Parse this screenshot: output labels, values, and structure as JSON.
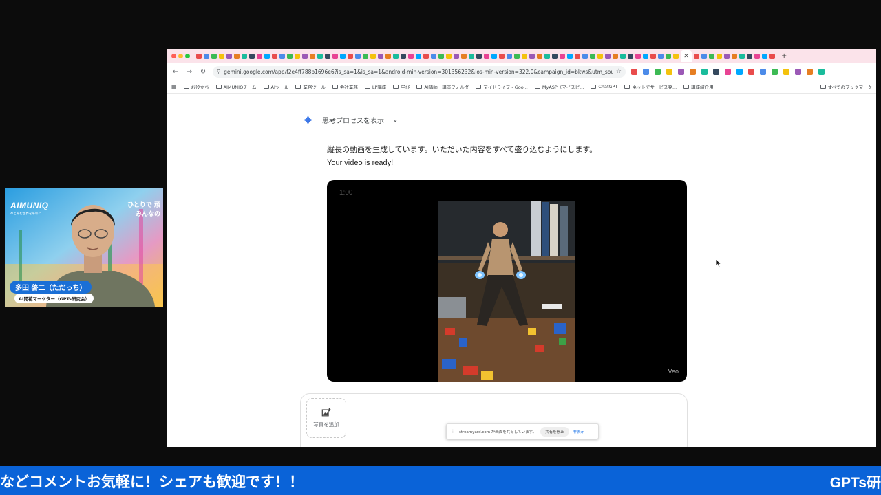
{
  "browser": {
    "url": "gemini.google.com/app/f2e4ff788b1696e6?is_sa=1&is_sa=1&android-min-version=301356232&ios-min-version=322.0&campaign_id=bkws&utm_source=...",
    "tab_active_label": "✕",
    "new_tab_label": "+",
    "nav": {
      "back": "←",
      "forward": "→",
      "reload": "↻"
    },
    "bookmarks": [
      {
        "label": "お役立ち"
      },
      {
        "label": "AIMUNIQチーム"
      },
      {
        "label": "AIツール"
      },
      {
        "label": "業務ツール"
      },
      {
        "label": "会社業務"
      },
      {
        "label": "LP講座"
      },
      {
        "label": "学び"
      },
      {
        "label": "AI講師　講座フォルダ"
      },
      {
        "label": "マイドライブ - Goo..."
      },
      {
        "label": "MyASP（マイスピ..."
      },
      {
        "label": "ChatGPT"
      },
      {
        "label": "ネットでサービス発..."
      },
      {
        "label": "講座紹介用"
      }
    ],
    "bookmarks_all": "すべてのブックマーク"
  },
  "gemini": {
    "thinking_label": "思考プロセスを表示",
    "chevron": "⌄",
    "message_line1": "縦長の動画を生成しています。いただいた内容をすべて盛り込むようにします。",
    "message_line2": "Your video is ready!",
    "video": {
      "time": "1:00",
      "watermark": "Veo"
    },
    "composer": {
      "add_photo_label": "写真を追加"
    }
  },
  "share_bar": {
    "message": "streamyard.com が画面を共有しています。",
    "stop_label": "共有を停止",
    "hide_label": "非表示"
  },
  "webcam": {
    "brand": "AIMUNIQ",
    "brand_sub": "AIと育む世界を平和に",
    "tagline1": "ひとりで 頑",
    "tagline2": "みんなの",
    "name": "多田 啓二（ただっち）",
    "title": "AI開花マーケター（GPTs研究会）"
  },
  "ticker": {
    "text": "などコメントお気軽に！シェアも歓迎です！！",
    "right_text": "GPTs研"
  },
  "colors": {
    "ticker_bg": "#0a63d8",
    "tabstrip_bg": "#fbe3ea",
    "gemini_accent": "#4285f4",
    "name_tag_bg": "#1a6fd6"
  }
}
